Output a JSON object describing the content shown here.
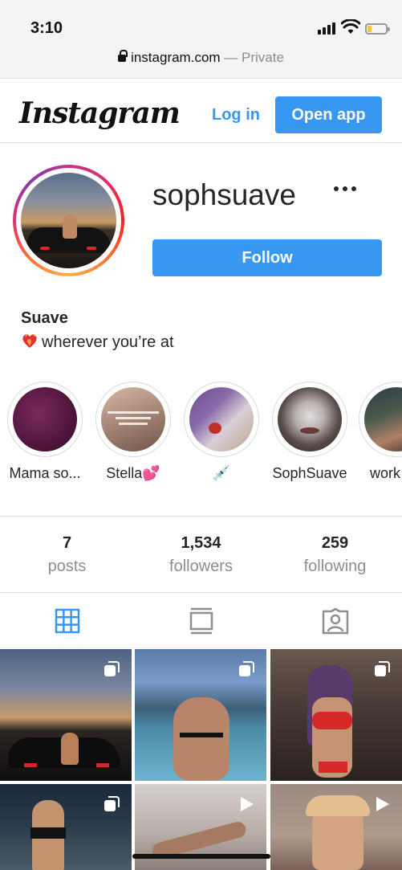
{
  "status_bar": {
    "time": "3:10",
    "url_domain": "instagram.com",
    "url_suffix": " — Private"
  },
  "header": {
    "logo": "Instagram",
    "login_label": "Log in",
    "open_app_label": "Open app"
  },
  "profile": {
    "username": "sophsuave",
    "follow_label": "Follow",
    "display_name": "Suave",
    "bio": "wherever you’re at"
  },
  "highlights": [
    {
      "label": "Mama so..."
    },
    {
      "label": "Stella💕"
    },
    {
      "label": "💉"
    },
    {
      "label": "SophSuave"
    },
    {
      "label": "work"
    }
  ],
  "stats": {
    "posts": {
      "value": "7",
      "label": "posts"
    },
    "followers": {
      "value": "1,534",
      "label": "followers"
    },
    "following": {
      "value": "259",
      "label": "following"
    }
  },
  "tabs": [
    "grid-icon",
    "feed-icon",
    "tagged-icon"
  ],
  "colors": {
    "accent": "#3897f0",
    "muted": "#8e8e8e",
    "text": "#262626",
    "border": "#dbdbdb"
  }
}
